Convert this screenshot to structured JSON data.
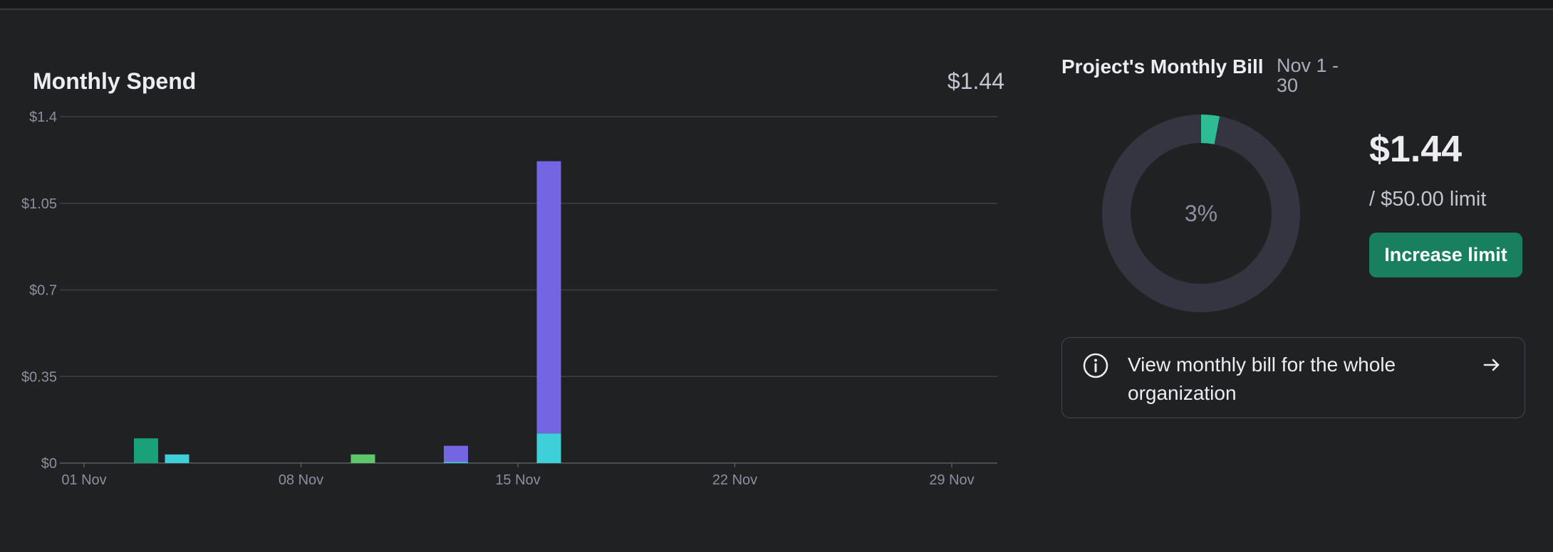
{
  "spend": {
    "title": "Monthly Spend",
    "total": "$1.44"
  },
  "chart_data": {
    "type": "bar",
    "stacked": true,
    "ylim": [
      0,
      1.4
    ],
    "y_ticks": [
      {
        "value": 0,
        "label": "$0"
      },
      {
        "value": 0.35,
        "label": "$0.35"
      },
      {
        "value": 0.7,
        "label": "$0.7"
      },
      {
        "value": 1.05,
        "label": "$1.05"
      },
      {
        "value": 1.4,
        "label": "$1.4"
      }
    ],
    "x_ticks": [
      {
        "day": 1,
        "label": "01 Nov"
      },
      {
        "day": 8,
        "label": "08 Nov"
      },
      {
        "day": 15,
        "label": "15 Nov"
      },
      {
        "day": 22,
        "label": "22 Nov"
      },
      {
        "day": 29,
        "label": "29 Nov"
      }
    ],
    "grid": true,
    "colors": {
      "green": "#19a27a",
      "cyan": "#3ed0d8",
      "lime": "#5dc76a",
      "purple": "#7466e3"
    },
    "bars": [
      {
        "day": 3,
        "segments": [
          {
            "color": "green",
            "value": 0.1
          }
        ]
      },
      {
        "day": 4,
        "segments": [
          {
            "color": "cyan",
            "value": 0.035
          }
        ]
      },
      {
        "day": 10,
        "segments": [
          {
            "color": "lime",
            "value": 0.035
          }
        ]
      },
      {
        "day": 13,
        "segments": [
          {
            "color": "cyan",
            "value": 0.005
          },
          {
            "color": "purple",
            "value": 0.065
          }
        ]
      },
      {
        "day": 16,
        "segments": [
          {
            "color": "cyan",
            "value": 0.12
          },
          {
            "color": "purple",
            "value": 1.1
          }
        ]
      }
    ]
  },
  "bill": {
    "title": "Project's Monthly Bill",
    "period": "Nov 1 - 30",
    "percent": 3,
    "percent_label": "3%",
    "amount": "$1.44",
    "limit": "/ $50.00 limit",
    "increase_label": "Increase limit",
    "track_color": "#343541",
    "fill_color": "#2ebd92"
  },
  "org_card": {
    "text": "View monthly bill for the whole organization",
    "info_icon": "info-circle-icon",
    "arrow_icon": "arrow-right-icon"
  }
}
